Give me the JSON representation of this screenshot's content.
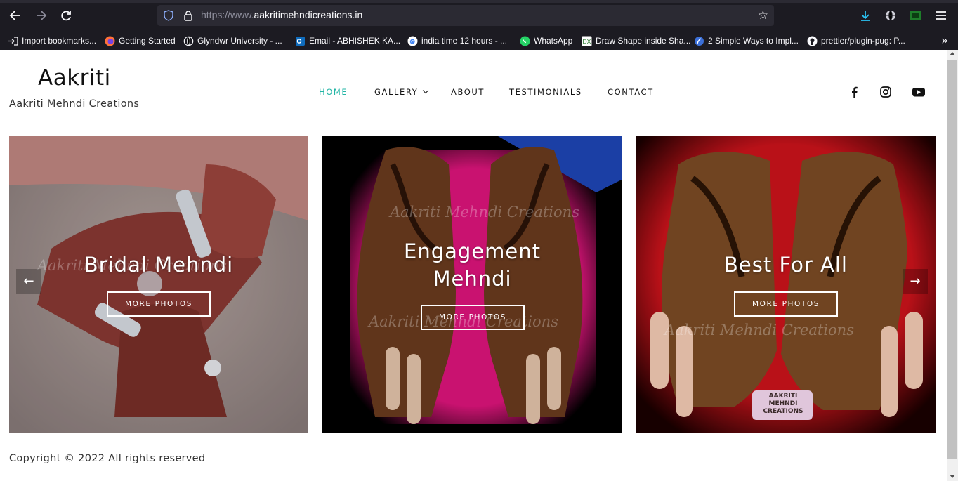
{
  "browser": {
    "url_protocol": "https://www.",
    "url_domain": "aakritimehndicreations.in",
    "bookmarks": [
      {
        "label": "Import bookmarks...",
        "icon": "import-icon"
      },
      {
        "label": "Getting Started",
        "icon": "firefox-icon"
      },
      {
        "label": "Glyndwr University - ...",
        "icon": "globe-icon"
      },
      {
        "label": "Email - ABHISHEK KA...",
        "icon": "outlook-icon"
      },
      {
        "label": "india time 12 hours - ...",
        "icon": "google-icon"
      },
      {
        "label": "WhatsApp",
        "icon": "whatsapp-icon"
      },
      {
        "label": "Draw Shape inside Sha...",
        "icon": "dx-icon"
      },
      {
        "label": "2 Simple Ways to Impl...",
        "icon": "site-icon"
      },
      {
        "label": "prettier/plugin-pug: P...",
        "icon": "github-icon"
      }
    ]
  },
  "site": {
    "title": "Aakriti",
    "subtitle": "Aakriti Mehndi Creations"
  },
  "nav": {
    "items": [
      {
        "label": "HOME",
        "active": true
      },
      {
        "label": "GALLERY",
        "dropdown": true
      },
      {
        "label": "ABOUT"
      },
      {
        "label": "TESTIMONIALS"
      },
      {
        "label": "CONTACT"
      }
    ],
    "accent_color": "#22b5a5"
  },
  "social": [
    "facebook-icon",
    "instagram-icon",
    "youtube-icon"
  ],
  "slides": [
    {
      "title": "Bridal Mehndi",
      "button": "MORE PHOTOS",
      "watermark": "Aakriti Mehndi Creations"
    },
    {
      "title_line1": "Engagement",
      "title_line2": "Mehndi",
      "button": "MORE PHOTOS",
      "watermark": "Aakriti Mehndi Creations"
    },
    {
      "title": "Best For All",
      "button": "MORE PHOTOS",
      "watermark": "Aakriti Mehndi Creations",
      "badge_line1": "AAKRITI",
      "badge_line2": "MEHNDI",
      "badge_line3": "CREATIONS"
    }
  ],
  "carousel": {
    "prev": "←",
    "next": "→"
  },
  "footer": {
    "copyright": "Copyright © 2022 All rights reserved"
  }
}
